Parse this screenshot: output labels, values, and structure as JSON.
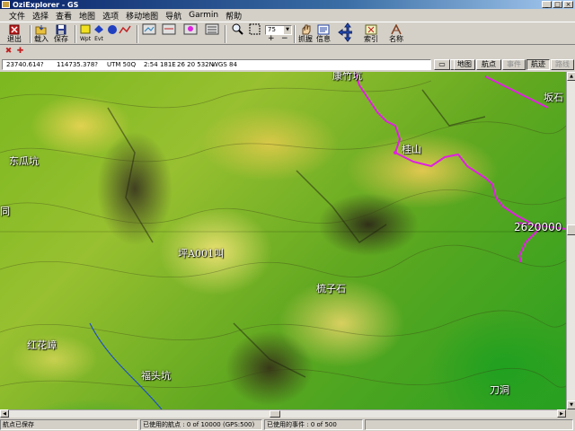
{
  "window": {
    "title": "OziExplorer - GS",
    "minimize": "_",
    "maximize": "□",
    "close": "×"
  },
  "menu": [
    "文件",
    "选择",
    "查看",
    "地图",
    "选项",
    "移动地图",
    "导航",
    "Garmin",
    "帮助"
  ],
  "toolbar": {
    "exit": "退出",
    "load": "载入",
    "save": "保存",
    "wpt": "Wpt",
    "evt": "Evt",
    "zoom_value": "75",
    "zoom_in": "+",
    "zoom_out": "−",
    "grab": "抓握",
    "info": "信息",
    "index": "索引",
    "name": "名称"
  },
  "coords": {
    "x": "23740.614?",
    "y": "114735.378?",
    "zone": "UTM  50Q",
    "east": "2:54 181E",
    "north": "26 20 532N",
    "datum": "WGS 84"
  },
  "mode_buttons": {
    "map": "地图",
    "waypoint": "航点",
    "event": "事件",
    "track": "航迹",
    "route": "路线"
  },
  "places": [
    {
      "label": "康竹坑"
    },
    {
      "label": "坂石"
    },
    {
      "label": "桂山"
    },
    {
      "label": "东瓜坑"
    },
    {
      "label": "同"
    },
    {
      "label": "2620000"
    },
    {
      "label": "坪A001叫"
    },
    {
      "label": "梳子石"
    },
    {
      "label": "红花嶂"
    },
    {
      "label": "福头坑"
    },
    {
      "label": "刀洞"
    }
  ],
  "status": {
    "saved": "航点已保存",
    "waypoints_label": "已使用的航点 :",
    "waypoints_value": "0 of 10000  (GPS:500)",
    "events_label": "已使用的事件 :",
    "events_value": "0 of 500"
  },
  "colors": {
    "track": "#e020e0",
    "title_start": "#0a246a",
    "title_end": "#a6caf0"
  },
  "icons": [
    "exit-icon",
    "load-icon",
    "save-icon",
    "waypoint-icon",
    "event-icon",
    "zoom-in-icon",
    "zoom-out-icon",
    "hand-icon",
    "info-icon",
    "move-arrows-icon",
    "index-icon",
    "name-icon"
  ]
}
